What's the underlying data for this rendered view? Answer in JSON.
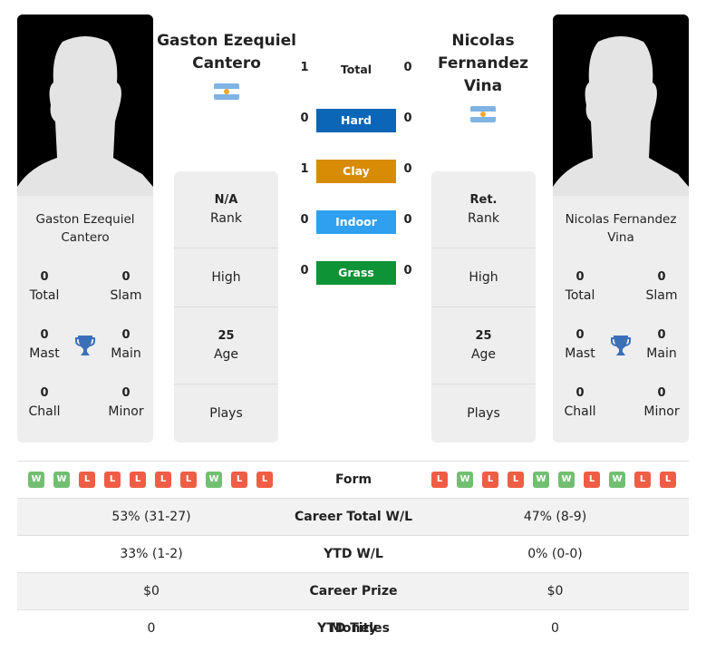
{
  "player1": {
    "name": "Gaston Ezequiel Cantero",
    "name_lines": [
      "Gaston Ezequiel",
      "Cantero"
    ],
    "card_name_lines": [
      "Gaston Ezequiel",
      "Cantero"
    ],
    "country_flag": "argentina-flag",
    "titles": {
      "total": {
        "value": "0",
        "label": "Total"
      },
      "slam": {
        "value": "0",
        "label": "Slam"
      },
      "mast": {
        "value": "0",
        "label": "Mast"
      },
      "main": {
        "value": "0",
        "label": "Main"
      },
      "chall": {
        "value": "0",
        "label": "Chall"
      },
      "minor": {
        "value": "0",
        "label": "Minor"
      }
    },
    "info": {
      "rank": {
        "value": "N/A",
        "label": "Rank"
      },
      "high": {
        "label": "High"
      },
      "age": {
        "value": "25",
        "label": "Age"
      },
      "plays": {
        "label": "Plays"
      }
    },
    "form": [
      "W",
      "W",
      "L",
      "L",
      "L",
      "L",
      "L",
      "W",
      "L",
      "L"
    ],
    "career_wl": "53% (31-27)",
    "ytd_wl": "33% (1-2)",
    "prize": "$0",
    "ytd_titles": "0"
  },
  "player2": {
    "name": "Nicolas Fernandez Vina",
    "name_lines": [
      "Nicolas",
      "Fernandez",
      "Vina"
    ],
    "card_name_lines": [
      "Nicolas Fernandez",
      "Vina"
    ],
    "country_flag": "argentina-flag",
    "titles": {
      "total": {
        "value": "0",
        "label": "Total"
      },
      "slam": {
        "value": "0",
        "label": "Slam"
      },
      "mast": {
        "value": "0",
        "label": "Mast"
      },
      "main": {
        "value": "0",
        "label": "Main"
      },
      "chall": {
        "value": "0",
        "label": "Chall"
      },
      "minor": {
        "value": "0",
        "label": "Minor"
      }
    },
    "info": {
      "rank": {
        "value": "Ret.",
        "label": "Rank"
      },
      "high": {
        "label": "High"
      },
      "age": {
        "value": "25",
        "label": "Age"
      },
      "plays": {
        "label": "Plays"
      }
    },
    "form": [
      "L",
      "W",
      "L",
      "L",
      "W",
      "W",
      "L",
      "W",
      "L",
      "L"
    ],
    "career_wl": "47% (8-9)",
    "ytd_wl": "0% (0-0)",
    "prize": "$0",
    "ytd_titles": "0"
  },
  "h2h": {
    "total": {
      "label": "Total",
      "p1": "1",
      "p2": "0"
    },
    "surfaces": [
      {
        "label": "Hard",
        "p1": "0",
        "p2": "0",
        "color": "#0b66b7"
      },
      {
        "label": "Clay",
        "p1": "1",
        "p2": "0",
        "color": "#d88c05"
      },
      {
        "label": "Indoor",
        "p1": "0",
        "p2": "0",
        "color": "#2f9ff0"
      },
      {
        "label": "Grass",
        "p1": "0",
        "p2": "0",
        "color": "#0f9337"
      }
    ]
  },
  "stats_labels": {
    "form": "Form",
    "career_wl": "Career Total W/L",
    "ytd_wl": "YTD W/L",
    "prize": "Career Prize Money",
    "ytd_titles": "YTD Titles"
  }
}
